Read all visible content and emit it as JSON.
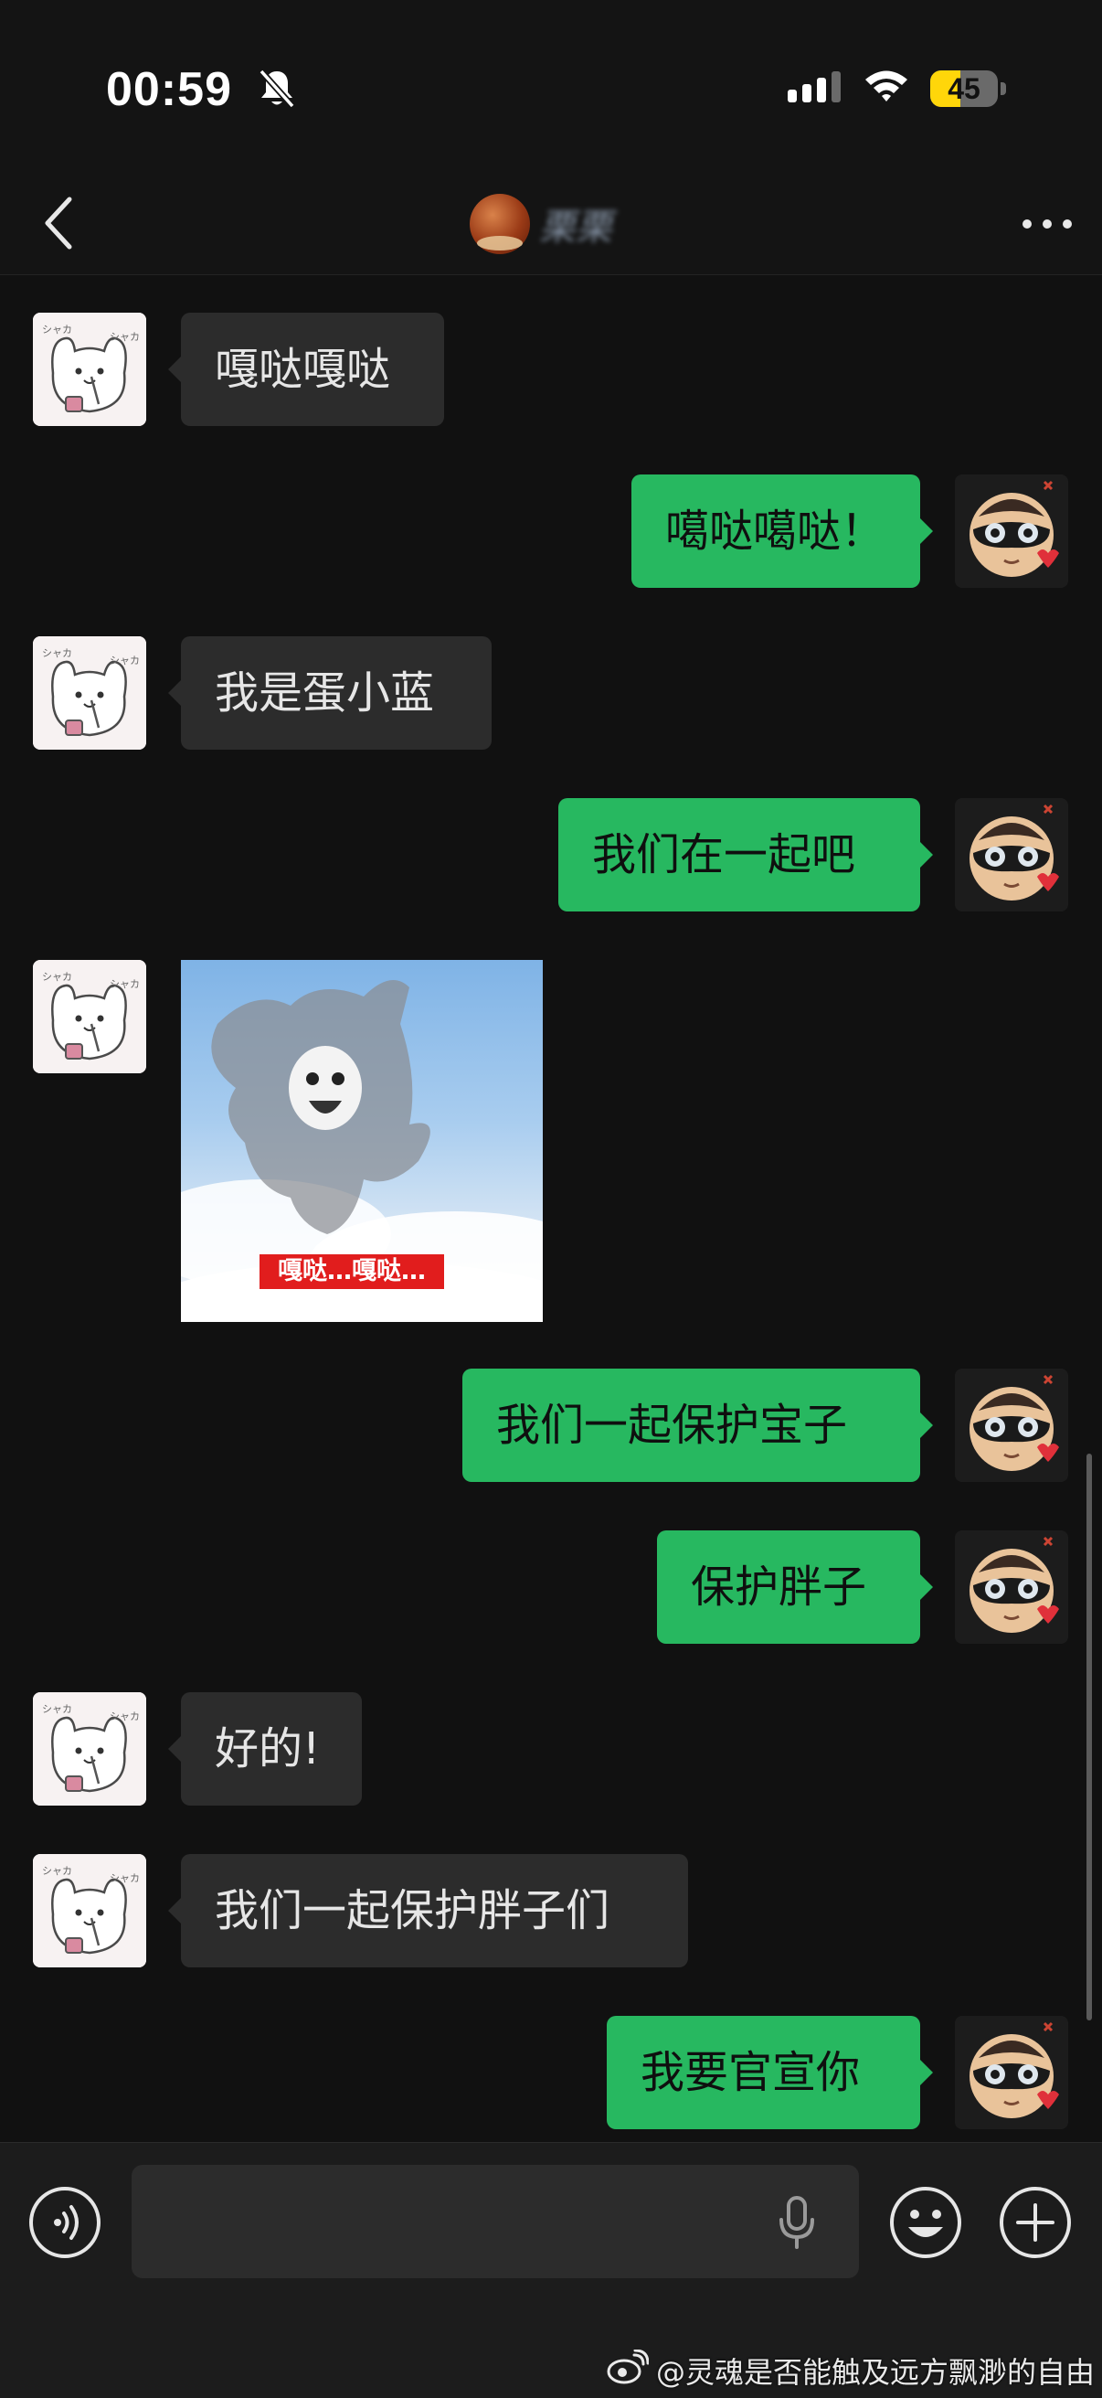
{
  "status_bar": {
    "time": "00:59",
    "battery_level": "45",
    "battery_fill_percent": 45,
    "icons": [
      "bell-off-icon",
      "signal-icon",
      "wifi-icon",
      "battery-icon"
    ]
  },
  "nav": {
    "back_icon": "chevron-left-icon",
    "title": "栗栗",
    "more_icon": "more-dots-icon"
  },
  "messages": [
    {
      "side": "in",
      "type": "text",
      "text": "嘎哒嘎哒"
    },
    {
      "side": "out",
      "type": "text",
      "text": "噶哒噶哒！"
    },
    {
      "side": "in",
      "type": "text",
      "text": "我是蛋小蓝"
    },
    {
      "side": "out",
      "type": "text",
      "text": "我们在一起吧"
    },
    {
      "side": "in",
      "type": "sticker",
      "caption": "嘎哒…嘎哒…"
    },
    {
      "side": "out",
      "type": "text",
      "text": "我们一起保护宝子"
    },
    {
      "side": "out",
      "type": "text",
      "text": "保护胖子"
    },
    {
      "side": "in",
      "type": "text",
      "text": "好的!"
    },
    {
      "side": "in",
      "type": "text",
      "text": "我们一起保护胖子们"
    },
    {
      "side": "out",
      "type": "text",
      "text": "我要官宣你"
    }
  ],
  "input_bar": {
    "placeholder": "",
    "icons": [
      "voice-icon",
      "mic-icon",
      "emoji-icon",
      "plus-icon"
    ]
  },
  "watermark": {
    "icon": "weibo-icon",
    "text": "@灵魂是否能触及远方飘渺的自由"
  },
  "colors": {
    "background": "#111111",
    "incoming_bubble": "#2c2c2c",
    "outgoing_bubble": "#27b860",
    "battery": "#ffd60a"
  }
}
